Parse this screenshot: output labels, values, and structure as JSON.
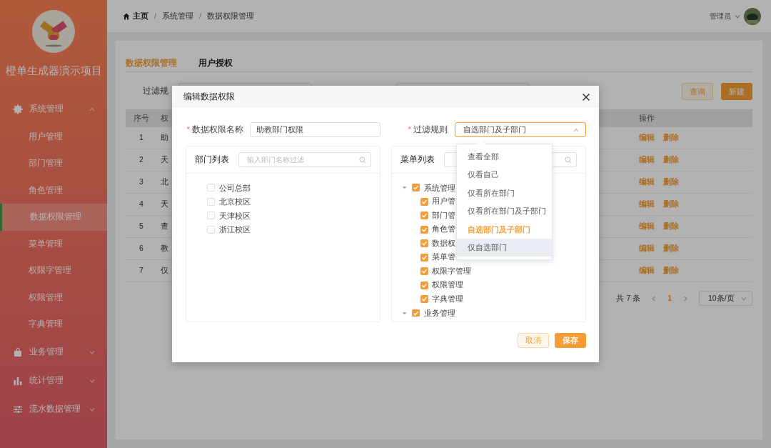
{
  "sidebar": {
    "title": "橙单生成器演示项目",
    "menu": [
      {
        "label": "系统管理",
        "kind": "gear",
        "expanded": true,
        "children": [
          {
            "label": "用户管理",
            "selected": false
          },
          {
            "label": "部门管理",
            "selected": false
          },
          {
            "label": "角色管理",
            "selected": false
          },
          {
            "label": "数据权限管理",
            "selected": true
          },
          {
            "label": "菜单管理",
            "selected": false
          },
          {
            "label": "权限字管理",
            "selected": false
          },
          {
            "label": "权限管理",
            "selected": false
          },
          {
            "label": "字典管理",
            "selected": false
          }
        ]
      },
      {
        "label": "业务管理",
        "kind": "bag",
        "expanded": false
      },
      {
        "label": "统计管理",
        "kind": "bars",
        "expanded": false
      },
      {
        "label": "流水数据管理",
        "kind": "sliders",
        "expanded": false
      }
    ]
  },
  "header": {
    "breadcrumb": [
      {
        "label": "主页",
        "kind": "home"
      },
      {
        "label": "系统管理",
        "kind": "link"
      },
      {
        "label": "数据权限管理",
        "kind": "link"
      }
    ],
    "separators": [
      "/",
      "/"
    ],
    "user": "管理员"
  },
  "tabs": [
    {
      "label": "数据权限管理",
      "selected": true
    },
    {
      "label": "用户授权",
      "selected": false
    }
  ],
  "filter": {
    "label": "过滤规"
  },
  "buttons": [
    {
      "label": "查询",
      "kind": "secondary"
    },
    {
      "label": "新建",
      "kind": "primary"
    }
  ],
  "table": {
    "columns": [
      "序号",
      "权",
      "操作"
    ],
    "rows": [
      {
        "index": "1",
        "name": "助",
        "actions": [
          "编辑",
          "删除"
        ]
      },
      {
        "index": "2",
        "name": "天",
        "actions": [
          "编辑",
          "删除"
        ]
      },
      {
        "index": "3",
        "name": "北",
        "actions": [
          "编辑",
          "删除"
        ]
      },
      {
        "index": "4",
        "name": "天",
        "actions": [
          "编辑",
          "删除"
        ]
      },
      {
        "index": "5",
        "name": "查",
        "actions": [
          "编辑",
          "删除"
        ]
      },
      {
        "index": "6",
        "name": "教",
        "actions": [
          "编辑",
          "删除"
        ]
      },
      {
        "index": "7",
        "name": "仅",
        "actions": [
          "编辑",
          "删除"
        ]
      }
    ]
  },
  "pagination": {
    "total": "共 7 条",
    "pages": [
      {
        "label": "1",
        "selected": true
      }
    ],
    "page_size": "10条/页"
  },
  "dialog": {
    "title": "编辑数据权限",
    "name_field": {
      "label": "数据权限名称",
      "required_mark": "*",
      "value": "助教部门权限"
    },
    "rule_field": {
      "label": "过滤规则",
      "required_mark": "*",
      "value": "自选部门及子部门",
      "expanded": true,
      "options": [
        {
          "label": "查看全部",
          "selected": false,
          "hovered": false
        },
        {
          "label": "仅看自己",
          "selected": false,
          "hovered": false
        },
        {
          "label": "仅看所在部门",
          "selected": false,
          "hovered": false
        },
        {
          "label": "仅看所在部门及子部门",
          "selected": false,
          "hovered": false
        },
        {
          "label": "自选部门及子部门",
          "selected": true,
          "hovered": false
        },
        {
          "label": "仅自选部门",
          "selected": false,
          "hovered": true
        }
      ]
    },
    "dept_panel": {
      "title": "部门列表",
      "placeholder": "输入部门名称过滤",
      "items": [
        {
          "label": "公司总部",
          "checked": false
        },
        {
          "label": "北京校区",
          "checked": false
        },
        {
          "label": "天津校区",
          "checked": false
        },
        {
          "label": "浙江校区",
          "checked": false
        }
      ]
    },
    "menu_panel": {
      "title": "菜单列表",
      "items": [
        {
          "label": "系统管理",
          "checked": true,
          "expanded": true,
          "children": [
            {
              "label": "用户管",
              "checked": true
            },
            {
              "label": "部门管",
              "checked": true
            },
            {
              "label": "角色管",
              "checked": true
            },
            {
              "label": "数据权",
              "checked": true
            },
            {
              "label": "菜单管",
              "checked": true
            },
            {
              "label": "权限字管理",
              "checked": true
            },
            {
              "label": "权限管理",
              "checked": true
            },
            {
              "label": "字典管理",
              "checked": true
            }
          ]
        },
        {
          "label": "业务管理",
          "checked": true,
          "expanded": true
        }
      ]
    },
    "buttons": [
      {
        "label": "取消",
        "kind": "secondary"
      },
      {
        "label": "保存",
        "kind": "primary"
      }
    ]
  }
}
